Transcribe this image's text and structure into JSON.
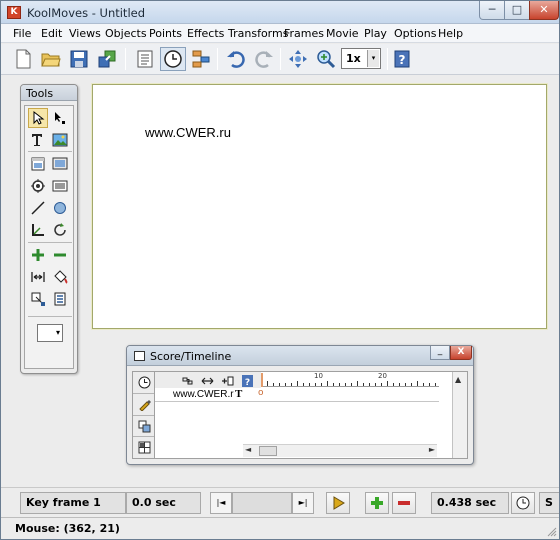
{
  "window": {
    "app_title": "KoolMoves - Untitled",
    "app_icon": "K",
    "minimize": "─",
    "maximize": "□",
    "close": "✕"
  },
  "menu": [
    "File",
    "Edit",
    "Views",
    "Objects",
    "Points",
    "Effects",
    "Transforms",
    "Frames",
    "Movie",
    "Play",
    "Options",
    "Help"
  ],
  "toolbar": {
    "buttons": [
      "new-file-icon",
      "open-folder-icon",
      "save-icon",
      "export-icon",
      "page-icon",
      "clock-icon",
      "sequence-icon",
      "undo-icon",
      "redo-icon",
      "pan-icon",
      "zoom-in-icon",
      "help-icon"
    ],
    "zoom_value": "1x",
    "zoom_arrow": "▾"
  },
  "tools": {
    "title": "Tools",
    "icons": [
      "arrow-select-icon",
      "point-select-icon",
      "text-tool-icon",
      "image-tool-icon",
      "window-tool-icon",
      "frame-tool-icon",
      "effects-icon",
      "shape-tool-icon",
      "line-tool-icon",
      "oval-tool-icon",
      "corner-tool-icon",
      "rotate-tool-icon",
      "add-point-icon",
      "remove-point-icon",
      "morph-icon",
      "fill-bucket-icon",
      "transform-icon",
      "gradient-icon"
    ],
    "fill_select": "▾"
  },
  "canvas": {
    "text": "www.CWER.ru"
  },
  "score": {
    "title": "Score/Timeline",
    "minimize": "_",
    "close": "X",
    "ruler_labels": [
      "10",
      "20"
    ],
    "layer_name": "www.CWER.r",
    "layer_type": "T",
    "layer_keyframe": "o",
    "scroll_up": "▲",
    "scroll_left": "◄",
    "scroll_right": "►"
  },
  "bottom": {
    "keyframe_label": "Key frame 1",
    "time_value": "0.0 sec",
    "slider_left": "|◄",
    "slider_right": "►|",
    "duration_value": "0.438 sec",
    "extra_label": "S"
  },
  "status": {
    "mouse": "Mouse: (362, 21)"
  },
  "colors": {
    "accent": "#d2452a",
    "play": "#d9a81a",
    "add": "#39a829",
    "remove": "#c92d2d",
    "canvas_border": "#a3a86a"
  }
}
